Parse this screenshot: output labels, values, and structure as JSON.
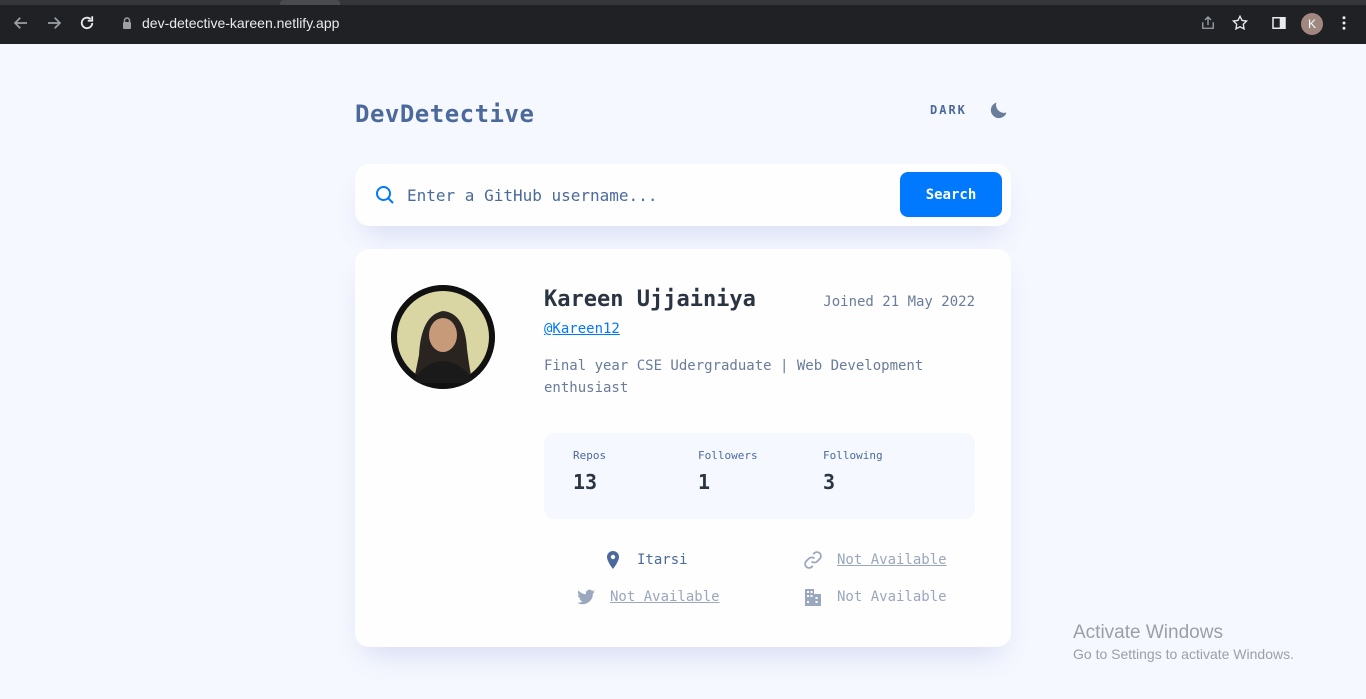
{
  "browser": {
    "url": "dev-detective-kareen.netlify.app",
    "profile_initial": "K"
  },
  "header": {
    "logo": "DevDetective",
    "theme_label": "DARK"
  },
  "search": {
    "placeholder": "Enter a GitHub username...",
    "button_label": "Search"
  },
  "profile": {
    "name": "Kareen Ujjainiya",
    "joined": "Joined 21 May 2022",
    "handle": "@Kareen12",
    "bio": "Final year CSE Udergraduate | Web Development enthusiast"
  },
  "stats": {
    "repos_label": "Repos",
    "repos_value": "13",
    "followers_label": "Followers",
    "followers_value": "1",
    "following_label": "Following",
    "following_value": "3"
  },
  "links": {
    "location": "Itarsi",
    "website": "Not Available",
    "twitter": "Not Available",
    "company": "Not Available"
  },
  "watermark": {
    "line1": "Activate Windows",
    "line2": "Go to Settings to activate Windows."
  },
  "colors": {
    "accent": "#0079ff",
    "text_dark": "#2b3442",
    "text_muted": "#697c9a",
    "text_blue": "#4b6a9b",
    "page_bg": "#f6f8ff"
  }
}
